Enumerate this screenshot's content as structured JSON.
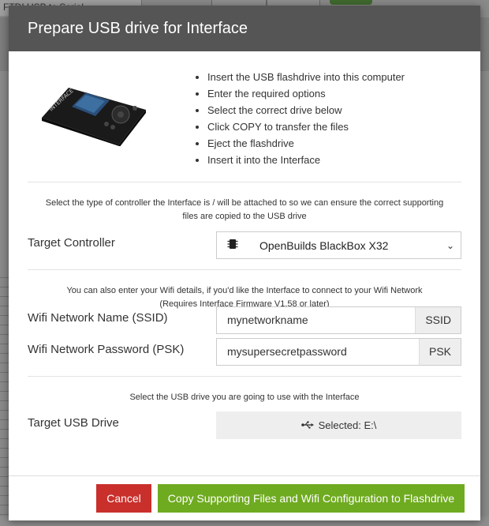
{
  "background": {
    "tab_label": "FTDI USB to Serial"
  },
  "modal": {
    "title": "Prepare USB drive for Interface",
    "steps": [
      "Insert the USB flashdrive into this computer",
      "Enter the required options",
      "Select the correct drive below",
      "Click COPY to transfer the files",
      "Eject the flashdrive",
      "Insert it into the Interface"
    ],
    "controller_note": "Select the type of controller the Interface is / will be attached to so we can ensure the correct supporting files are copied to the USB drive",
    "target_controller": {
      "label": "Target Controller",
      "value": "OpenBuilds BlackBox X32",
      "icon": "chip-icon"
    },
    "wifi_note_line1": "You can also enter your Wifi details, if you'd like the Interface to connect to your Wifi Network",
    "wifi_note_line2": "(Requires Interface Firmware V1.58 or later)",
    "ssid": {
      "label": "Wifi Network Name (SSID)",
      "value": "mynetworkname",
      "addon": "SSID"
    },
    "psk": {
      "label": "Wifi Network Password (PSK)",
      "value": "mysupersecretpassword",
      "addon": "PSK"
    },
    "usb_note": "Select the USB drive you are going to use with the Interface",
    "usb": {
      "label": "Target USB Drive",
      "value": "Selected: E:\\",
      "icon": "usb-icon"
    },
    "buttons": {
      "cancel": "Cancel",
      "copy": "Copy Supporting Files and Wifi Configuration to Flashdrive"
    },
    "colors": {
      "header": "#555555",
      "cancel": "#c9302c",
      "copy": "#6fab20"
    }
  }
}
